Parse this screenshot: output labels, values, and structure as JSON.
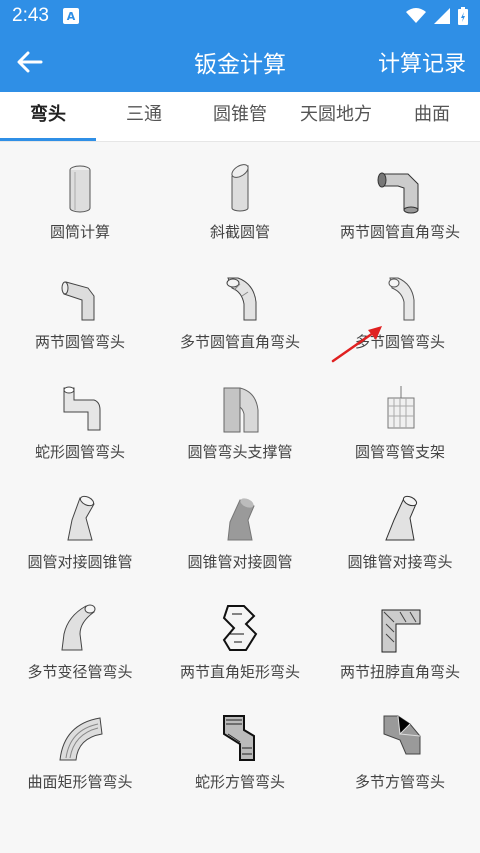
{
  "status_bar": {
    "time": "2:43",
    "badge": "A"
  },
  "app_bar": {
    "title": "钣金计算",
    "history_label": "计算记录"
  },
  "tabs": [
    {
      "label": "弯头",
      "active": true
    },
    {
      "label": "三通",
      "active": false
    },
    {
      "label": "圆锥管",
      "active": false
    },
    {
      "label": "天圆地方",
      "active": false
    },
    {
      "label": "曲面",
      "active": false
    }
  ],
  "items": [
    {
      "label": "圆筒计算",
      "icon": "cylinder-icon"
    },
    {
      "label": "斜截圆管",
      "icon": "oblique-cut-pipe-icon"
    },
    {
      "label": "两节圆管直角弯头",
      "icon": "two-section-right-angle-elbow-icon"
    },
    {
      "label": "两节圆管弯头",
      "icon": "two-section-elbow-icon"
    },
    {
      "label": "多节圆管直角弯头",
      "icon": "multi-section-right-angle-elbow-icon"
    },
    {
      "label": "多节圆管弯头",
      "icon": "multi-section-elbow-icon"
    },
    {
      "label": "蛇形圆管弯头",
      "icon": "snake-elbow-icon"
    },
    {
      "label": "圆管弯头支撑管",
      "icon": "elbow-support-pipe-icon"
    },
    {
      "label": "圆管弯管支架",
      "icon": "pipe-bracket-icon"
    },
    {
      "label": "圆管对接圆锥管",
      "icon": "pipe-to-cone-icon"
    },
    {
      "label": "圆锥管对接圆管",
      "icon": "cone-to-pipe-icon"
    },
    {
      "label": "圆锥管对接弯头",
      "icon": "cone-to-elbow-icon"
    },
    {
      "label": "多节变径管弯头",
      "icon": "reducing-elbow-icon"
    },
    {
      "label": "两节直角矩形弯头",
      "icon": "rectangular-elbow-icon"
    },
    {
      "label": "两节扭脖直角弯头",
      "icon": "twisted-neck-elbow-icon"
    },
    {
      "label": "曲面矩形管弯头",
      "icon": "curved-rectangular-elbow-icon"
    },
    {
      "label": "蛇形方管弯头",
      "icon": "snake-square-elbow-icon"
    },
    {
      "label": "多节方管弯头",
      "icon": "multi-section-square-elbow-icon"
    }
  ],
  "colors": {
    "primary": "#2f8fe6",
    "annotation_arrow": "#e02020"
  }
}
